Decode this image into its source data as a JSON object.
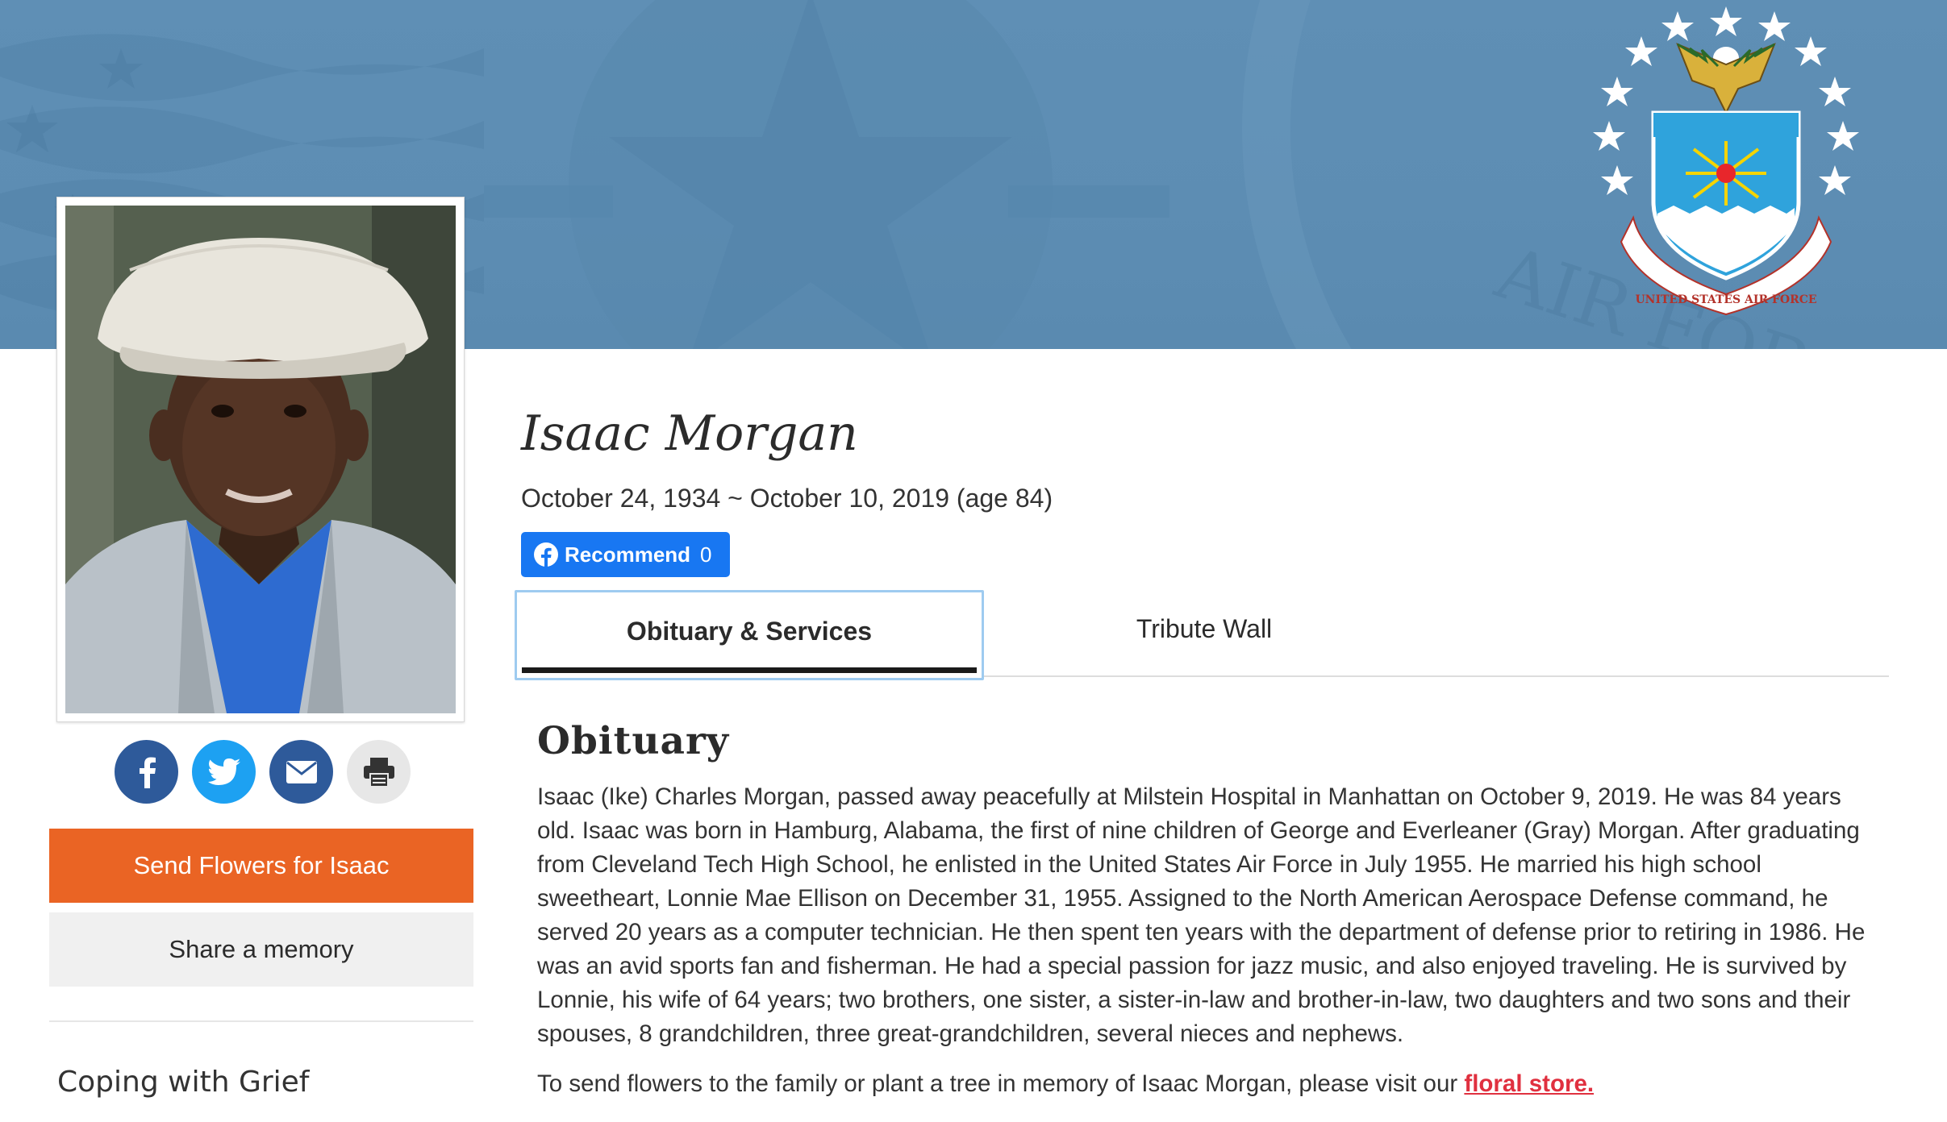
{
  "banner": {
    "seal_icon": "us-air-force-seal-icon",
    "seal_text": "AIR FORCE",
    "seal_ribbon_text": "UNITED STATES AIR FORCE"
  },
  "sidebar": {
    "share_icons": [
      "facebook-icon",
      "twitter-icon",
      "email-icon",
      "print-icon"
    ],
    "send_flowers_label": "Send Flowers for Isaac",
    "share_memory_label": "Share a memory",
    "coping_title": "Coping with Grief"
  },
  "person": {
    "name": "Isaac Morgan",
    "dates": "October 24, 1934 ~ October 10, 2019 (age 84)"
  },
  "recommend": {
    "label": "Recommend",
    "count": "0"
  },
  "tabs": [
    {
      "label": "Obituary & Services",
      "active": true
    },
    {
      "label": "Tribute Wall",
      "active": false
    }
  ],
  "obituary": {
    "title": "Obituary",
    "body": "Isaac (Ike) Charles Morgan, passed away peacefully at Milstein Hospital in Manhattan on October 9, 2019. He was 84 years old. Isaac was born in Hamburg, Alabama, the first of nine children of George and Everleaner (Gray) Morgan. After graduating from Cleveland Tech High School, he enlisted in the United States Air Force in July 1955. He married his high school sweetheart, Lonnie Mae Ellison on December 31, 1955. Assigned to the North American Aerospace Defense command, he served 20 years as a computer technician. He then spent ten years with the department of defense prior to retiring in 1986. He was an avid sports fan and fisherman. He had a special passion for jazz music, and also enjoyed traveling. He is survived by Lonnie, his wife of 64 years; two brothers, one sister, a sister-in-law and brother-in-law, two daughters and two sons and their spouses, 8 grandchildren, three great-grandchildren, several nieces and nephews.",
    "flowers_text": "To send flowers to the family or plant a tree in memory of Isaac Morgan, please visit our ",
    "floral_link": "floral store."
  },
  "colors": {
    "banner": "#5f8fb5",
    "flowers_button": "#ea6424",
    "facebook": "#2e5a9a",
    "twitter": "#1da1f2",
    "fb_recommend": "#1877f2",
    "tab_focus": "#9ecbf0",
    "link": "#e0303f"
  }
}
